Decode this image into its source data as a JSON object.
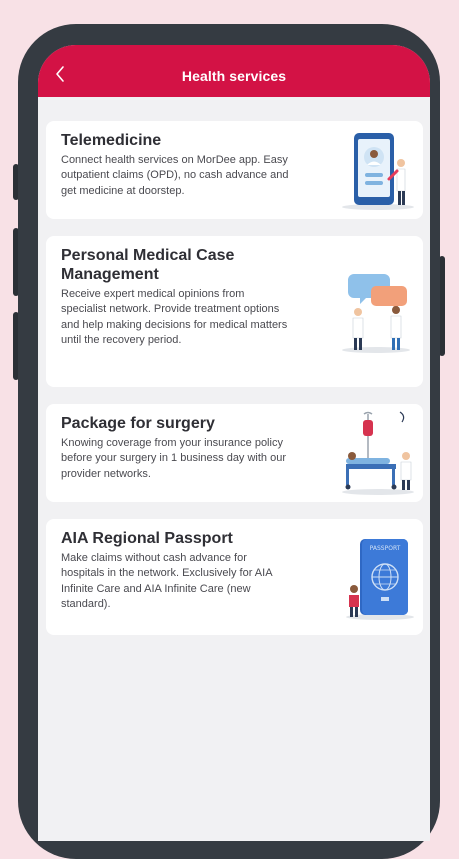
{
  "header": {
    "title": "Health services",
    "back_icon": "chevron-left-icon",
    "color": "#d31245"
  },
  "services": [
    {
      "title": "Telemedicine",
      "description": "Connect health services on MorDee app. Easy outpatient claims (OPD), no cash advance and get medicine at doorstep.",
      "illustration": "doctor-on-phone-icon"
    },
    {
      "title": "Personal Medical Case Management",
      "description": "Receive expert medical opinions from specialist network. Provide treatment options and help making decisions for medical matters until the recovery period.",
      "illustration": "doctors-consultation-icon"
    },
    {
      "title": "Package for surgery",
      "description": "Knowing coverage from your insurance policy before your surgery in 1 business day with our provider networks.",
      "illustration": "hospital-bed-icon"
    },
    {
      "title": "AIA Regional Passport",
      "description": "Make claims without cash advance for hospitals in the network. Exclusively for AIA Infinite Care and AIA Infinite Care (new standard).",
      "illustration": "passport-icon",
      "passport_label": "PASSPORT"
    }
  ]
}
